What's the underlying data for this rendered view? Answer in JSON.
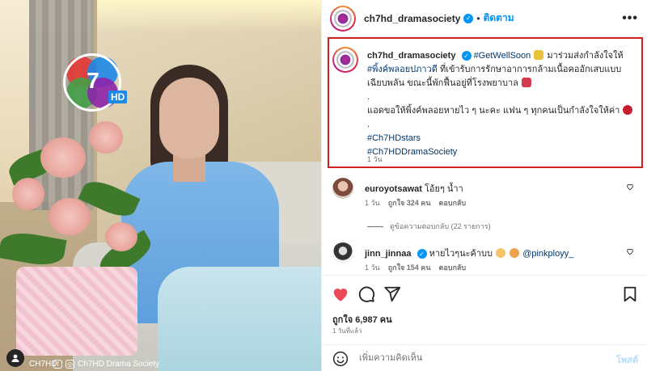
{
  "photo": {
    "brand_digit": "7",
    "hd_tag": "HD",
    "watermark_handle": "CH7HD",
    "watermark_brand": "Ch7HD Drama Society"
  },
  "post": {
    "username": "ch7hd_dramasociety",
    "follow_label": "ติดตาม",
    "separator": "•",
    "more_label": "•••",
    "caption": {
      "username": "ch7hd_dramasociety",
      "tag_getwell": "#GetWellSoon",
      "line1_text": "มาร่วมส่งกำลังใจให้",
      "tag_name": "#พิ้งค์พลอยปภาวดี",
      "line2_text": "ที่เข้ารับการรักษาอาการกล้ามเนื้อคออักเสบแบบเฉียบพลัน ขณะนี้พักฟื้นอยู่ที่โรงพยาบาล",
      "dot": ".",
      "line3_text": "แอดขอให้พิ้งค์พลอยหายไว ๆ นะคะ แฟน ๆ ทุกคนเป็นกำลังใจให้ค่า",
      "tag_stars": "#Ch7HDstars",
      "tag_society": "#Ch7HDDramaSociety",
      "time": "1 วัน"
    },
    "comments": [
      {
        "username": "euroyotsawat",
        "text": "โอ้ยๆ น้ำา",
        "time": "1 วัน",
        "likes": "ถูกใจ 324 คน",
        "reply_label": "ตอบกลับ"
      },
      {
        "username": "jinn_jinnaa",
        "text": "หายไวๆนะค้าบบ",
        "mention": "@pinkployy_",
        "time": "1 วัน",
        "likes": "ถูกใจ 154 คน",
        "reply_label": "ตอบกลับ"
      }
    ],
    "view_replies": "ดูข้อความตอบกลับ (22 รายการ)",
    "likes_total": "ถูกใจ 6,987 คน",
    "posted_ago": "1 วันที่แล้ว",
    "comment_placeholder": "เพิ่มความคิดเห็น",
    "post_label": "โพสต์"
  },
  "colors": {
    "accent": "#0095f6",
    "highlight_border": "#d21f1f",
    "like_red": "#ed4956",
    "hashtag": "#00376b"
  }
}
